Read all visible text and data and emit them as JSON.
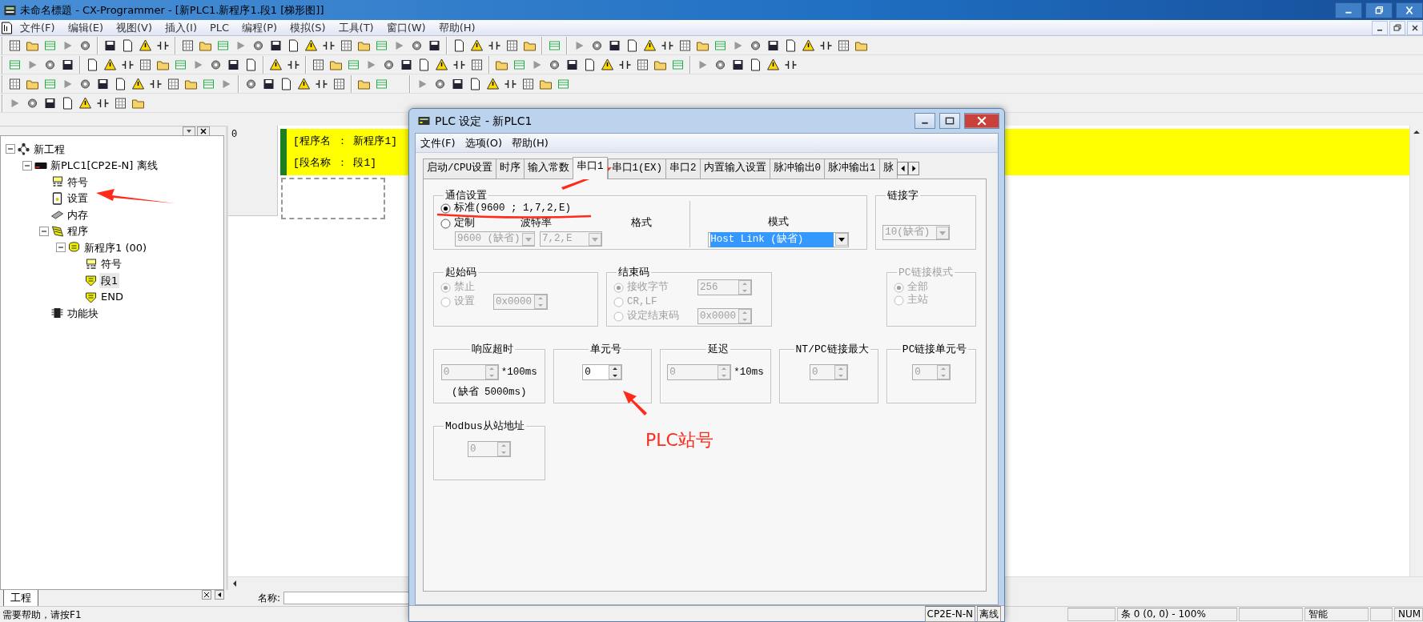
{
  "window": {
    "title": "未命名標題 - CX-Programmer - [新PLC1.新程序1.段1 [梯形图]]"
  },
  "menu": [
    "文件(F)",
    "编辑(E)",
    "视图(V)",
    "插入(I)",
    "PLC",
    "编程(P)",
    "模拟(S)",
    "工具(T)",
    "窗口(W)",
    "帮助(H)"
  ],
  "project_tree": {
    "tab": "工程",
    "items": [
      {
        "label": "新工程",
        "kind": "project",
        "selected": false,
        "expanded": true,
        "children": [
          {
            "label": "新PLC1[CP2E-N] 离线",
            "kind": "plc",
            "selected": false,
            "expanded": true,
            "children": [
              {
                "label": "符号",
                "kind": "symbols",
                "selected": false
              },
              {
                "label": "设置",
                "kind": "settings",
                "selected": false
              },
              {
                "label": "内存",
                "kind": "memory",
                "selected": false
              },
              {
                "label": "程序",
                "kind": "programs",
                "selected": false,
                "expanded": true,
                "children": [
                  {
                    "label": "新程序1 (00)",
                    "kind": "program",
                    "selected": false,
                    "expanded": true,
                    "children": [
                      {
                        "label": "符号",
                        "kind": "symbols",
                        "selected": false
                      },
                      {
                        "label": "段1",
                        "kind": "section",
                        "selected": true
                      },
                      {
                        "label": "END",
                        "kind": "section",
                        "selected": false
                      }
                    ]
                  }
                ]
              },
              {
                "label": "功能块",
                "kind": "function-blocks",
                "selected": false
              }
            ]
          }
        ]
      }
    ]
  },
  "ladder": {
    "rung_number": "0",
    "program_name": "[程序名 ： 新程序1]",
    "section_name": "[段名称 ： 段1]"
  },
  "name_bar": {
    "label": "名称:"
  },
  "status_bar": {
    "help": "需要帮助，请按F1",
    "position": "条 0 (0, 0) - 100%",
    "mode": "智能",
    "num": "NUM"
  },
  "dialog": {
    "title": "PLC 设定 - 新PLC1",
    "menu": [
      "文件(F)",
      "选项(O)",
      "帮助(H)"
    ],
    "tabs": [
      {
        "label": "启动/CPU设置",
        "selected": false
      },
      {
        "label": "时序",
        "selected": false
      },
      {
        "label": "输入常数",
        "selected": false
      },
      {
        "label": "串口1",
        "selected": true
      },
      {
        "label": "串口1(EX)",
        "selected": false
      },
      {
        "label": "串口2",
        "selected": false
      },
      {
        "label": "内置输入设置",
        "selected": false
      },
      {
        "label": "脉冲输出0",
        "selected": false
      },
      {
        "label": "脉冲输出1",
        "selected": false
      },
      {
        "label": "脉",
        "selected": false
      }
    ],
    "comm_settings": {
      "title": "通信设置",
      "options": [
        {
          "label": "标准(9600 ; 1,7,2,E)",
          "selected": true
        },
        {
          "label": "定制",
          "selected": false
        }
      ],
      "baud_rate": {
        "label": "波特率",
        "value": "9600 (缺省)",
        "disabled": true
      },
      "format": {
        "label": "格式",
        "value": "7,2,E",
        "disabled": true
      },
      "mode": {
        "label": "模式",
        "value": "Host Link (缺省)",
        "disabled": false,
        "highlighted": true
      }
    },
    "link_word": {
      "title": "链接字",
      "value": "10(缺省)",
      "disabled": true
    },
    "start_code": {
      "title": "起始码",
      "disabled": true,
      "options": [
        {
          "label": "禁止",
          "selected": true
        },
        {
          "label": "设置",
          "selected": false
        }
      ],
      "value": "0x0000"
    },
    "end_code": {
      "title": "结束码",
      "disabled": true,
      "options": [
        {
          "label": "接收字节",
          "selected": true
        },
        {
          "label": "CR,LF",
          "selected": false
        },
        {
          "label": "设定结束码",
          "selected": false
        }
      ],
      "byte_count": "256",
      "code": "0x0000"
    },
    "pc_link_mode": {
      "title": "PC链接模式",
      "title_disabled": true,
      "disabled": true,
      "options": [
        {
          "label": "全部",
          "selected": true
        },
        {
          "label": "主站",
          "selected": false
        }
      ]
    },
    "numeric_settings": [
      {
        "title": "响应超时",
        "value": "0",
        "unit": "*100ms",
        "note": "(缺省 5000ms)",
        "disabled": true
      },
      {
        "title": "单元号",
        "value": "0",
        "disabled": false
      },
      {
        "title": "延迟",
        "value": "0",
        "unit": "*10ms",
        "disabled": true
      },
      {
        "title": "NT/PC链接最大",
        "value": "0",
        "disabled": true
      },
      {
        "title": "PC链接单元号",
        "value": "0",
        "disabled": true
      }
    ],
    "modbus": {
      "title": "Modbus从站地址",
      "value": "0",
      "disabled": true
    },
    "status": [
      "CP2E-N-N",
      "离线"
    ]
  },
  "annotation": {
    "text": "PLC站号"
  }
}
